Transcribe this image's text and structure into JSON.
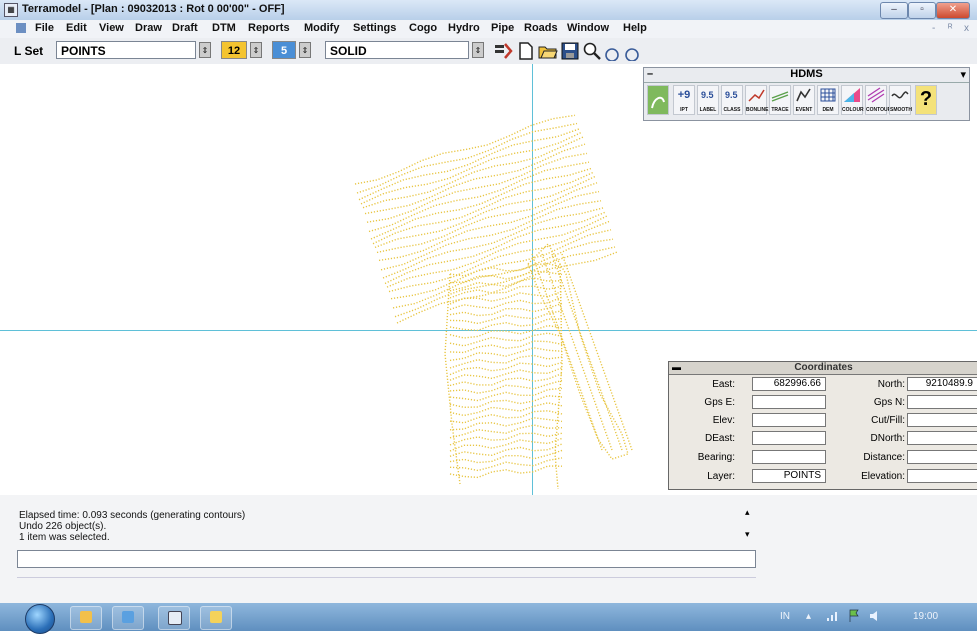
{
  "window": {
    "title": "Terramodel - [Plan : 09032013 : Rot 0 00'00\" - OFF]",
    "buttons": {
      "minimize": "–",
      "maximize": "▫",
      "close": "✕"
    }
  },
  "menu": {
    "items": [
      "File",
      "Edit",
      "View",
      "Draw",
      "Draft",
      "DTM",
      "Reports",
      "Modify",
      "Settings",
      "Cogo",
      "Hydro",
      "Pipe",
      "Roads",
      "Window",
      "Help"
    ],
    "mdi_buttons": [
      "-",
      "ᴿ",
      "x"
    ]
  },
  "toolbar": {
    "lset_label": "L Set",
    "layer_value": "POINTS",
    "color_value": "12",
    "weight_value": "5",
    "linetype_value": "SOLID",
    "spin_glyph": "⇕",
    "colors": {
      "color_box": "#f4c430",
      "weight_box": "#4b8fd6"
    }
  },
  "hdms": {
    "title": "HDMS",
    "minimize": "–",
    "dropdown": "▾",
    "tools": [
      "",
      "+9",
      "LABEL",
      "CLASS",
      "BONLINE",
      "TRACE",
      "EVENT",
      "DEM",
      "COLOUR",
      "CONTOUR",
      "SMOOTH",
      "?"
    ]
  },
  "coordinates": {
    "title": "Coordinates",
    "fields": {
      "east_label": "East:",
      "east_value": "682996.66",
      "north_label": "North:",
      "north_value": "9210489.9",
      "gpse_label": "Gps E:",
      "gpse_value": "",
      "gpsn_label": "Gps N:",
      "gpsn_value": "",
      "elev_label": "Elev:",
      "elev_value": "",
      "cutfill_label": "Cut/Fill:",
      "cutfill_value": "",
      "deast_label": "DEast:",
      "deast_value": "",
      "dnorth_label": "DNorth:",
      "dnorth_value": "",
      "bearing_label": "Bearing:",
      "bearing_value": "",
      "distance_label": "Distance:",
      "distance_value": "",
      "layer_label": "Layer:",
      "layer_value": "POINTS",
      "elevation_label": "Elevation:",
      "elevation_value": ""
    }
  },
  "output": {
    "lines": [
      "Elapsed time: 0.093 seconds (generating contours)",
      "Undo 226 object(s).",
      "1 item was selected."
    ],
    "scroll_up": "▴",
    "scroll_down": "▾"
  },
  "taskbar": {
    "tray_lang": "IN",
    "tray_time": "19:00"
  },
  "colors": {
    "contour": "#e8c542",
    "crosshair": "#5fc0d8"
  }
}
